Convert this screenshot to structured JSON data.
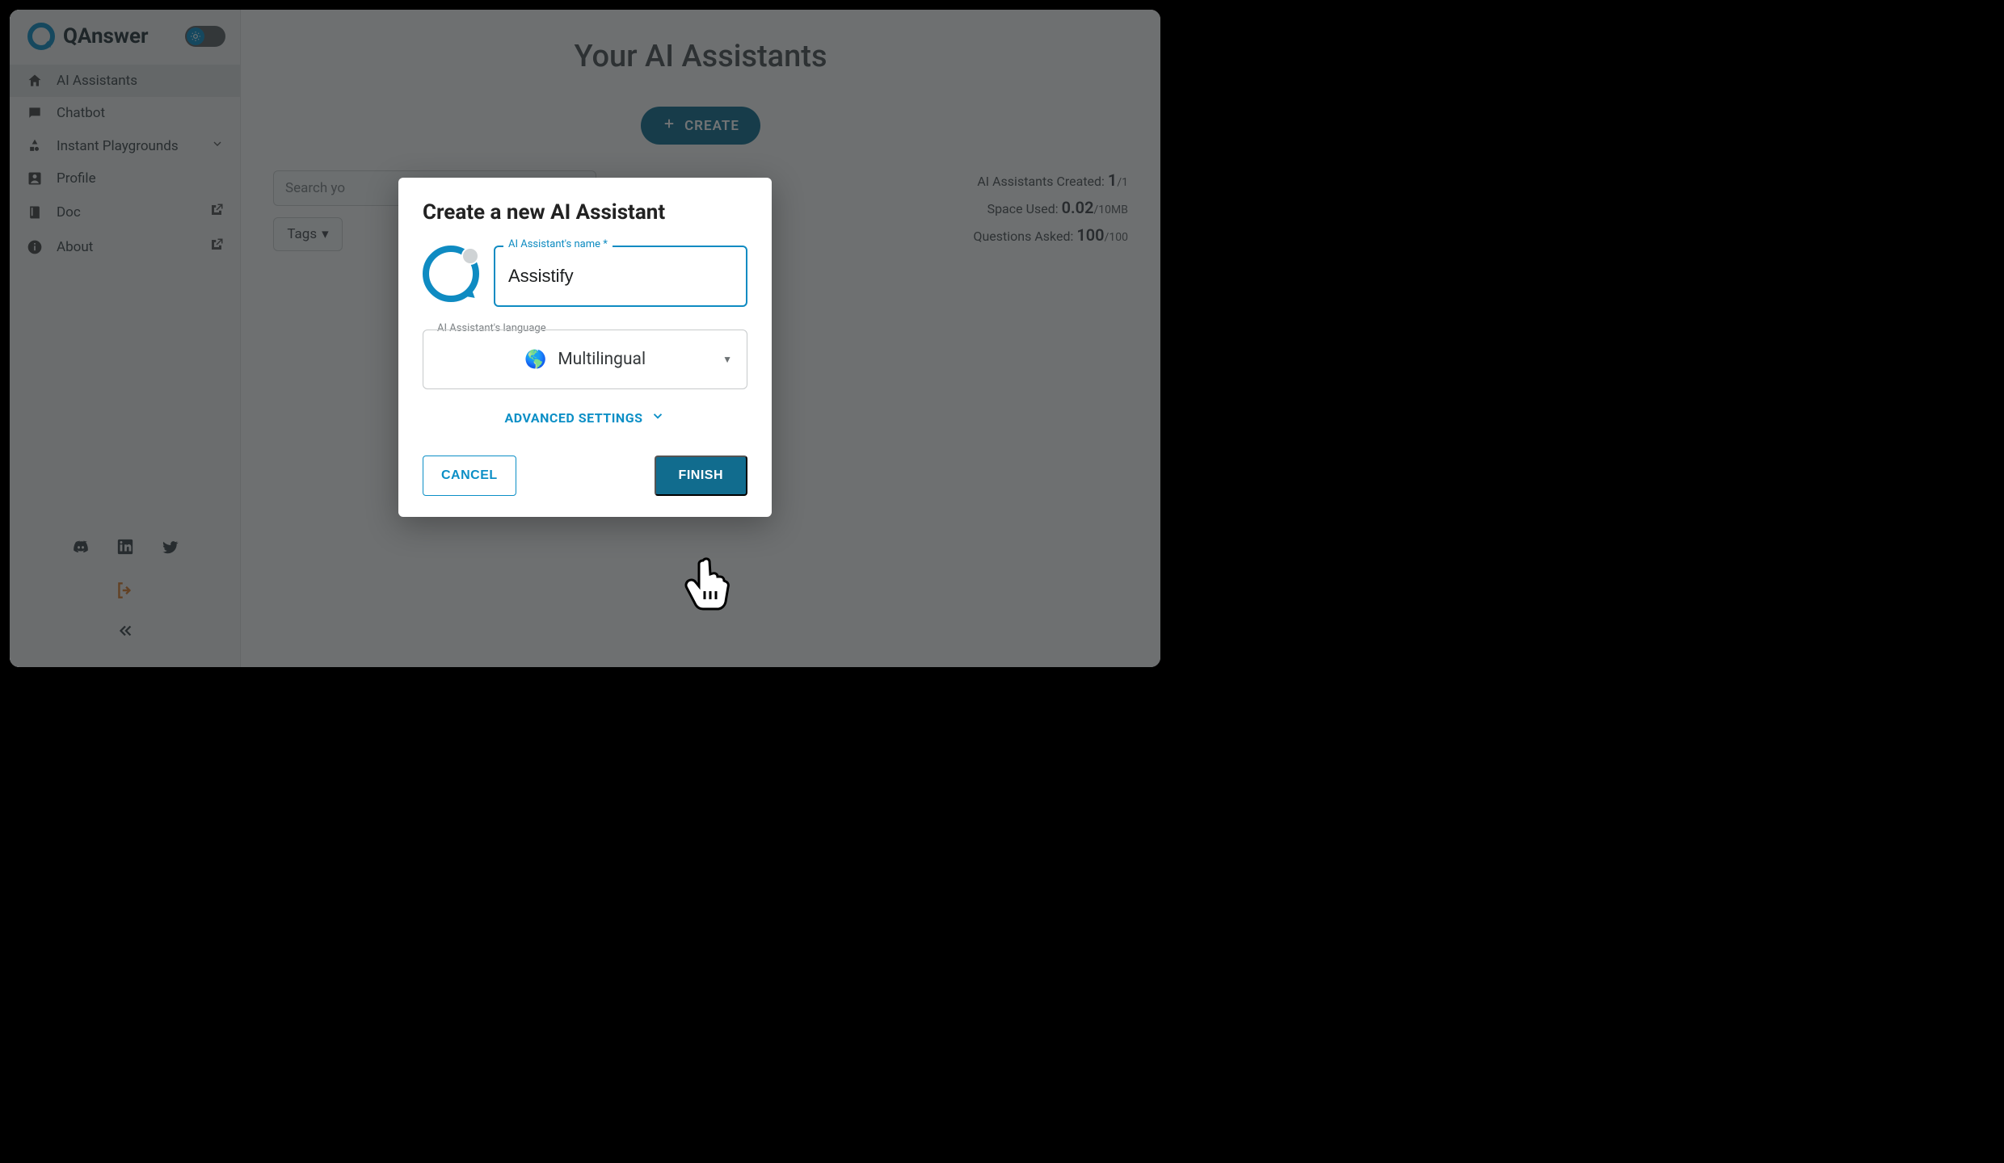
{
  "brand": "QAnswer",
  "sidebar": {
    "items": [
      {
        "label": "AI Assistants"
      },
      {
        "label": "Chatbot"
      },
      {
        "label": "Instant Playgrounds"
      },
      {
        "label": "Profile"
      },
      {
        "label": "Doc"
      },
      {
        "label": "About"
      }
    ]
  },
  "main": {
    "title": "Your AI Assistants",
    "create_label": "CREATE",
    "search_placeholder": "Search yo",
    "tags_label": "Tags",
    "stats": {
      "created_label": "AI Assistants Created:",
      "created_value": "1",
      "created_max": "/1",
      "space_label": "Space Used:",
      "space_value": "0.02",
      "space_max": "/10MB",
      "questions_label": "Questions Asked:",
      "questions_value": "100",
      "questions_max": "/100"
    }
  },
  "modal": {
    "title": "Create a new AI Assistant",
    "name_label": "AI Assistant's name",
    "name_required": "*",
    "name_value": "Assistify",
    "lang_label": "AI Assistant's language",
    "lang_value": "Multilingual",
    "advanced_label": "ADVANCED SETTINGS",
    "cancel_label": "CANCEL",
    "finish_label": "FINISH"
  }
}
